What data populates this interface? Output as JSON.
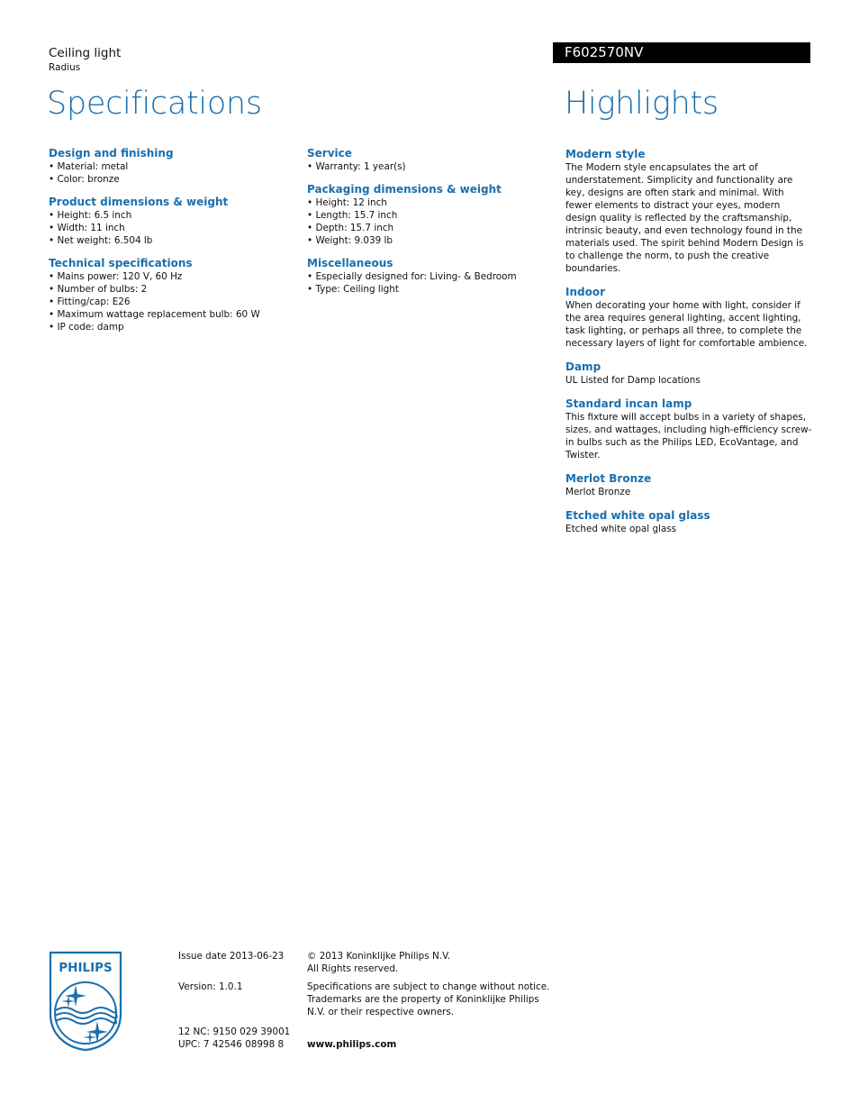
{
  "header": {
    "product_type": "Ceiling light",
    "product_name": "Radius",
    "model": "F602570NV",
    "spec_title": "Specifications",
    "highlights_title": "Highlights"
  },
  "specifications": {
    "column1": [
      {
        "heading": "Design and finishing",
        "items": [
          "Material: metal",
          "Color: bronze"
        ]
      },
      {
        "heading": "Product dimensions & weight",
        "items": [
          "Height: 6.5 inch",
          "Width: 11 inch",
          "Net weight: 6.504 lb"
        ]
      },
      {
        "heading": "Technical specifications",
        "items": [
          "Mains power: 120 V, 60 Hz",
          "Number of bulbs: 2",
          "Fitting/cap: E26",
          "Maximum wattage replacement bulb: 60 W",
          "IP code: damp"
        ]
      }
    ],
    "column2": [
      {
        "heading": "Service",
        "items": [
          "Warranty: 1 year(s)"
        ]
      },
      {
        "heading": "Packaging dimensions & weight",
        "items": [
          "Height: 12 inch",
          "Length: 15.7 inch",
          "Depth: 15.7 inch",
          "Weight: 9.039 lb"
        ]
      },
      {
        "heading": "Miscellaneous",
        "items": [
          "Especially designed for: Living- & Bedroom",
          "Type: Ceiling light"
        ]
      }
    ]
  },
  "highlights": [
    {
      "heading": "Modern style",
      "body": "The Modern style encapsulates the art of understatement. Simplicity and functionality are key, designs are often stark and minimal. With fewer elements to distract your eyes, modern design quality is reflected by the craftsmanship, intrinsic beauty, and even technology found in the materials used. The spirit behind Modern Design is to challenge the norm, to push the creative boundaries."
    },
    {
      "heading": "Indoor",
      "body": "When decorating your home with light, consider if the area requires general lighting, accent lighting, task lighting, or perhaps all three, to complete the necessary layers of light for comfortable ambience."
    },
    {
      "heading": "Damp",
      "body": "UL Listed for Damp locations"
    },
    {
      "heading": "Standard incan lamp",
      "body": "This fixture will accept bulbs in a variety of shapes, sizes, and wattages, including high-efficiency screw-in bulbs such as the Philips LED, EcoVantage, and Twister."
    },
    {
      "heading": "Merlot Bronze",
      "body": "Merlot Bronze"
    },
    {
      "heading": "Etched white opal glass",
      "body": "Etched white opal glass"
    }
  ],
  "footer": {
    "logo_text": "PHILIPS",
    "issue_date": "Issue date 2013-06-23",
    "version": "Version: 1.0.1",
    "nc": "12 NC: 9150 029 39001",
    "upc": "UPC: 7 42546 08998 8",
    "copyright_line1": "© 2013 Koninklijke Philips N.V.",
    "copyright_line2": "All Rights reserved.",
    "disclaimer": "Specifications are subject to change without notice. Trademarks are the property of Koninklijke Philips N.V. or their respective owners.",
    "website": "www.philips.com"
  },
  "colors": {
    "accent": "#1a6fae",
    "model_bar": "#000000"
  }
}
